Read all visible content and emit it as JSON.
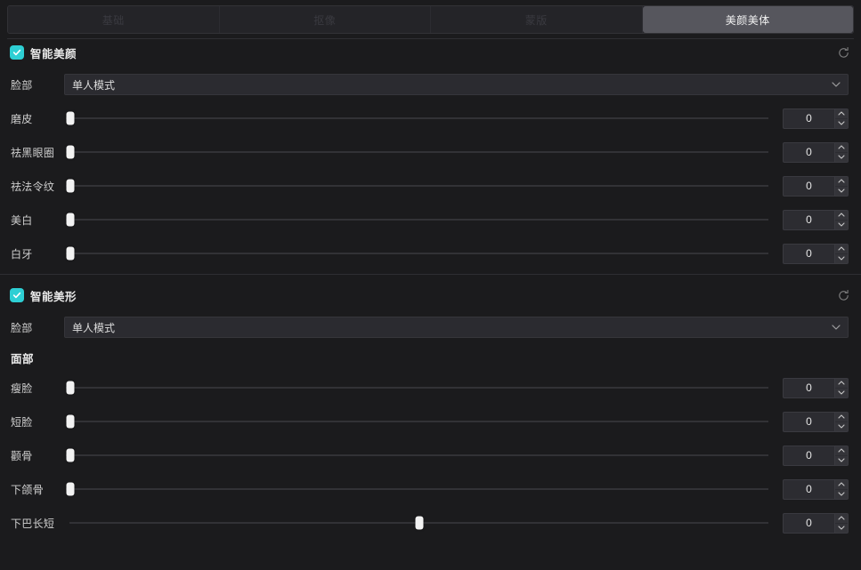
{
  "tabs": [
    {
      "label": "基础",
      "active": false
    },
    {
      "label": "抠像",
      "active": false
    },
    {
      "label": "蒙版",
      "active": false
    },
    {
      "label": "美颜美体",
      "active": true
    }
  ],
  "colors": {
    "accent": "#2ecfd4",
    "panel_bg": "#1b1b1d",
    "tab_active_bg": "#56565d",
    "slider_thumb": "#f2f2f2",
    "track": "#4a4a50"
  },
  "icons": {
    "reset": "reset-circle-icon",
    "chevron_down": "chevron-down-icon",
    "stepper_up": "chevron-up-icon",
    "stepper_down": "chevron-down-icon",
    "checkmark": "check-icon"
  },
  "sections": [
    {
      "id": "smart-beauty",
      "title": "智能美颜",
      "enabled": true,
      "reset_label": "重置",
      "mode": {
        "label": "脸部",
        "value": "单人模式",
        "options": [
          "单人模式"
        ]
      },
      "sliders": [
        {
          "label": "磨皮",
          "value": "0",
          "percent": 0
        },
        {
          "label": "祛黑眼圈",
          "value": "0",
          "percent": 0
        },
        {
          "label": "祛法令纹",
          "value": "0",
          "percent": 0
        },
        {
          "label": "美白",
          "value": "0",
          "percent": 0
        },
        {
          "label": "白牙",
          "value": "0",
          "percent": 0
        }
      ]
    },
    {
      "id": "smart-reshape",
      "title": "智能美形",
      "enabled": true,
      "reset_label": "重置",
      "mode": {
        "label": "脸部",
        "value": "单人模式",
        "options": [
          "单人模式"
        ]
      },
      "subhead": "面部",
      "sliders": [
        {
          "label": "瘦脸",
          "value": "0",
          "percent": 0
        },
        {
          "label": "短脸",
          "value": "0",
          "percent": 0
        },
        {
          "label": "颧骨",
          "value": "0",
          "percent": 0
        },
        {
          "label": "下颌骨",
          "value": "0",
          "percent": 0
        },
        {
          "label": "下巴长短",
          "value": "0",
          "percent": 50
        }
      ]
    }
  ]
}
